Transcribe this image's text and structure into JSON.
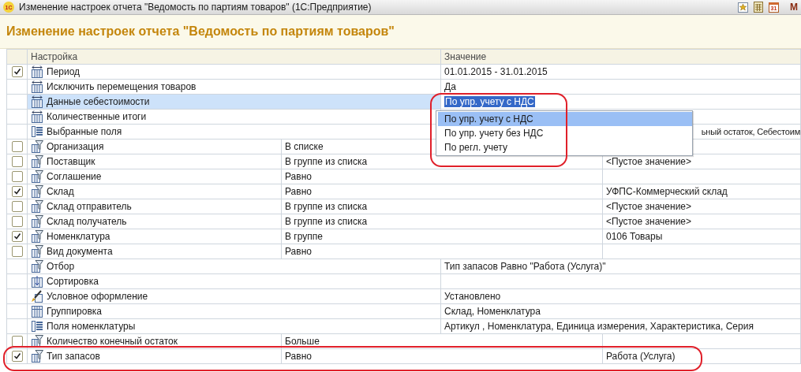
{
  "window": {
    "logo": "1С",
    "title": "Изменение настроек отчета \"Ведомость по партиям товаров\"  (1С:Предприятие)",
    "calendar_day": "31",
    "menu_letter": "М"
  },
  "heading": "Изменение настроек отчета \"Ведомость по партиям товаров\"",
  "table": {
    "columns": [
      "Настройка",
      "Значение"
    ],
    "rows": [
      {
        "kind": "parameter",
        "checked": true,
        "name": "Период",
        "value": "01.01.2015 - 31.01.2015",
        "selected": false
      },
      {
        "kind": "parameter",
        "name": "Исключить перемещения товаров",
        "value": "Да",
        "selected": false
      },
      {
        "kind": "parameter",
        "name": "Данные себестоимости",
        "value": "По упр. учету с НДС",
        "selected": true,
        "editing": true
      },
      {
        "kind": "parameter",
        "name": "Количественные итоги",
        "selected": false
      },
      {
        "kind": "fields",
        "name": "Выбранные поля",
        "value": "ьный остаток, Себестоим",
        "selected": false,
        "covered": true
      },
      {
        "kind": "filter",
        "checked": false,
        "name": "Организация",
        "condition": "В списке",
        "selected": false
      },
      {
        "kind": "filter",
        "checked": false,
        "name": "Поставщик",
        "condition": "В группе из списка",
        "value": "<Пустое значение>",
        "selected": false
      },
      {
        "kind": "filter",
        "checked": false,
        "name": "Соглашение",
        "condition": "Равно",
        "selected": false
      },
      {
        "kind": "filter",
        "checked": true,
        "name": "Склад",
        "condition": "Равно",
        "value": "УФПС-Коммерческий склад",
        "selected": false
      },
      {
        "kind": "filter",
        "checked": false,
        "name": "Склад отправитель",
        "condition": "В группе из списка",
        "value": "<Пустое значение>",
        "selected": false
      },
      {
        "kind": "filter",
        "checked": false,
        "name": "Склад получатель",
        "condition": "В группе из списка",
        "value": "<Пустое значение>",
        "selected": false
      },
      {
        "kind": "filter",
        "checked": true,
        "name": "Номенклатура",
        "condition": "В группе",
        "value": "0106 Товары",
        "selected": false
      },
      {
        "kind": "filter",
        "checked": false,
        "name": "Вид документа",
        "condition": "Равно",
        "selected": false
      },
      {
        "kind": "selection",
        "name": "Отбор",
        "value": "Тип запасов Равно \"Работа (Услуга)\"",
        "selected": false
      },
      {
        "kind": "sort",
        "name": "Сортировка",
        "selected": false
      },
      {
        "kind": "appearance",
        "name": "Условное оформление",
        "value": "Установлено",
        "selected": false
      },
      {
        "kind": "grouping",
        "name": "Группировка",
        "value": "Склад, Номенклатура",
        "selected": false
      },
      {
        "kind": "fields",
        "name": "Поля номенклатуры",
        "value": "Артикул , Номенклатура, Единица измерения, Характеристика, Серия",
        "selected": false
      },
      {
        "kind": "filter",
        "checked": false,
        "name": "Количество конечный остаток",
        "condition": "Больше",
        "selected": false
      },
      {
        "kind": "filter",
        "checked": true,
        "name": "Тип запасов",
        "condition": "Равно",
        "value": "Работа (Услуга)",
        "selected": false
      }
    ]
  },
  "dropdown": {
    "items": [
      {
        "label": "По упр. учету с НДС",
        "selected": true
      },
      {
        "label": "По упр. учету без НДС",
        "selected": false
      },
      {
        "label": "По регл. учету",
        "selected": false
      }
    ]
  }
}
